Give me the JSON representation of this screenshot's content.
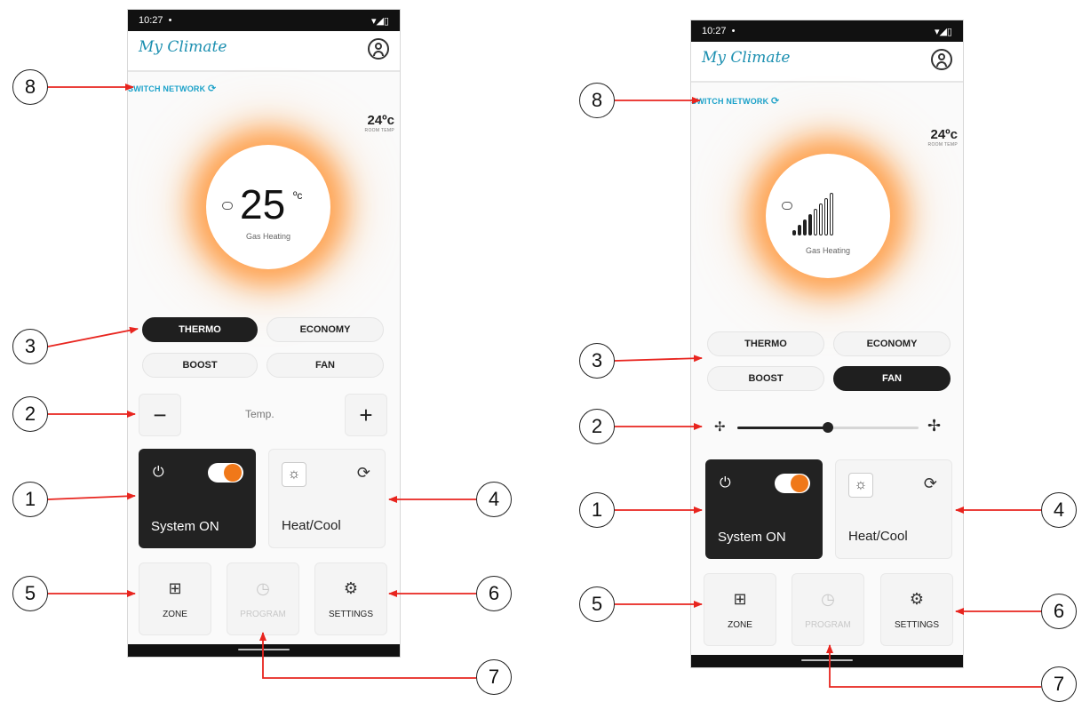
{
  "phones": [
    {
      "status_time": "10:27",
      "status_dot": "•",
      "status_icons": "▾◢▯",
      "app_title": "My Climate",
      "switch_network": "SWITCH NETWORK",
      "room_temp_value": "24ºc",
      "room_temp_label": "ROOM TEMP",
      "set_temp": "25",
      "set_temp_unit": "ºc",
      "heating_mode": "Gas Heating",
      "modes": {
        "thermo": "THERMO",
        "economy": "ECONOMY",
        "boost": "BOOST",
        "fan": "FAN"
      },
      "active_mode": "THERMO",
      "temp_label": "Temp.",
      "minus": "−",
      "plus": "+",
      "system_label": "System ON",
      "system_on": true,
      "heatcool_label": "Heat/Cool",
      "tiles": {
        "zone": "ZONE",
        "program": "PROGRAM",
        "settings": "SETTINGS"
      }
    },
    {
      "status_time": "10:27",
      "status_dot": "•",
      "status_icons": "▾◢▯",
      "app_title": "My Climate",
      "switch_network": "SWITCH NETWORK",
      "room_temp_value": "24ºc",
      "room_temp_label": "ROOM TEMP",
      "heating_mode": "Gas Heating",
      "fan_level_bars": 4,
      "fan_total_bars": 8,
      "modes": {
        "thermo": "THERMO",
        "economy": "ECONOMY",
        "boost": "BOOST",
        "fan": "FAN"
      },
      "active_mode": "FAN",
      "fan_speed_fraction": 0.5,
      "system_label": "System ON",
      "system_on": true,
      "heatcool_label": "Heat/Cool",
      "tiles": {
        "zone": "ZONE",
        "program": "PROGRAM",
        "settings": "SETTINGS"
      }
    }
  ],
  "callouts": [
    "8",
    "3",
    "2",
    "1",
    "4",
    "5",
    "6",
    "7"
  ],
  "colors": {
    "accent_orange": "#f07819",
    "network_blue": "#1aa1c9",
    "callout_red": "#e8251f",
    "dark_card": "#222222"
  }
}
